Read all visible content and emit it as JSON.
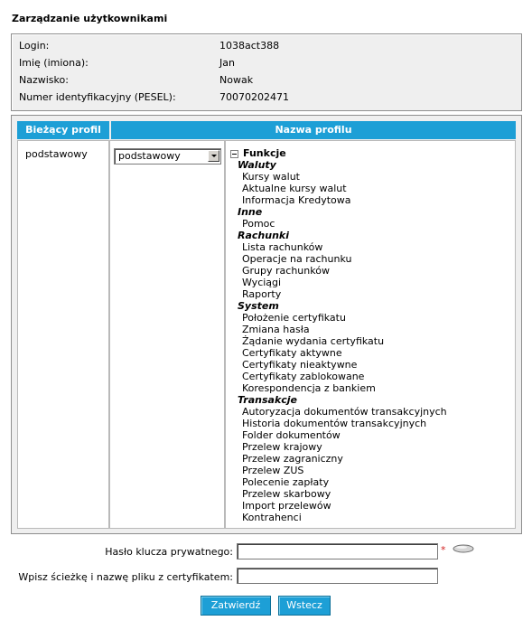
{
  "title": "Zarządzanie użytkownikami",
  "user_info": [
    {
      "label": "Login:",
      "value": "1038act388"
    },
    {
      "label": "Imię (imiona):",
      "value": "Jan"
    },
    {
      "label": "Nazwisko:",
      "value": "Nowak"
    },
    {
      "label": "Numer identyfikacyjny (PESEL):",
      "value": "70070202471"
    }
  ],
  "profiles": {
    "current_header": "Bieżący profil",
    "name_header": "Nazwa profilu",
    "current_value": "podstawowy",
    "select_value": "podstawowy"
  },
  "tree": {
    "root": "Funkcje",
    "groups": [
      {
        "name": "Waluty",
        "items": [
          "Kursy walut",
          "Aktualne kursy walut",
          "Informacja Kredytowa"
        ]
      },
      {
        "name": "Inne",
        "items": [
          "Pomoc"
        ]
      },
      {
        "name": "Rachunki",
        "items": [
          "Lista rachunków",
          "Operacje na rachunku",
          "Grupy rachunków",
          "Wyciągi",
          "Raporty"
        ]
      },
      {
        "name": "System",
        "items": [
          "Położenie certyfikatu",
          "Zmiana hasła",
          "Żądanie wydania certyfikatu",
          "Certyfikaty aktywne",
          "Certyfikaty nieaktywne",
          "Certyfikaty zablokowane",
          "Korespondencja z bankiem"
        ]
      },
      {
        "name": "Transakcje",
        "items": [
          "Autoryzacja dokumentów transakcyjnych",
          "Historia dokumentów transakcyjnych",
          "Folder dokumentów",
          "Przelew krajowy",
          "Przelew zagraniczny",
          "Przelew ZUS",
          "Polecenie zapłaty",
          "Przelew skarbowy",
          "Import przelewów",
          "Kontrahenci"
        ]
      }
    ]
  },
  "form": {
    "key_password_label": "Hasło klucza prywatnego:",
    "key_password_value": "",
    "required_mark": "*",
    "cert_path_label": "Wpisz ścieżkę i nazwę pliku z certyfikatem:",
    "cert_path_value": ""
  },
  "buttons": {
    "confirm": "Zatwierdź",
    "back": "Wstecz"
  },
  "colors": {
    "accent": "#1d9fd6",
    "panel_bg": "#efefef",
    "required": "#d21f1f"
  }
}
